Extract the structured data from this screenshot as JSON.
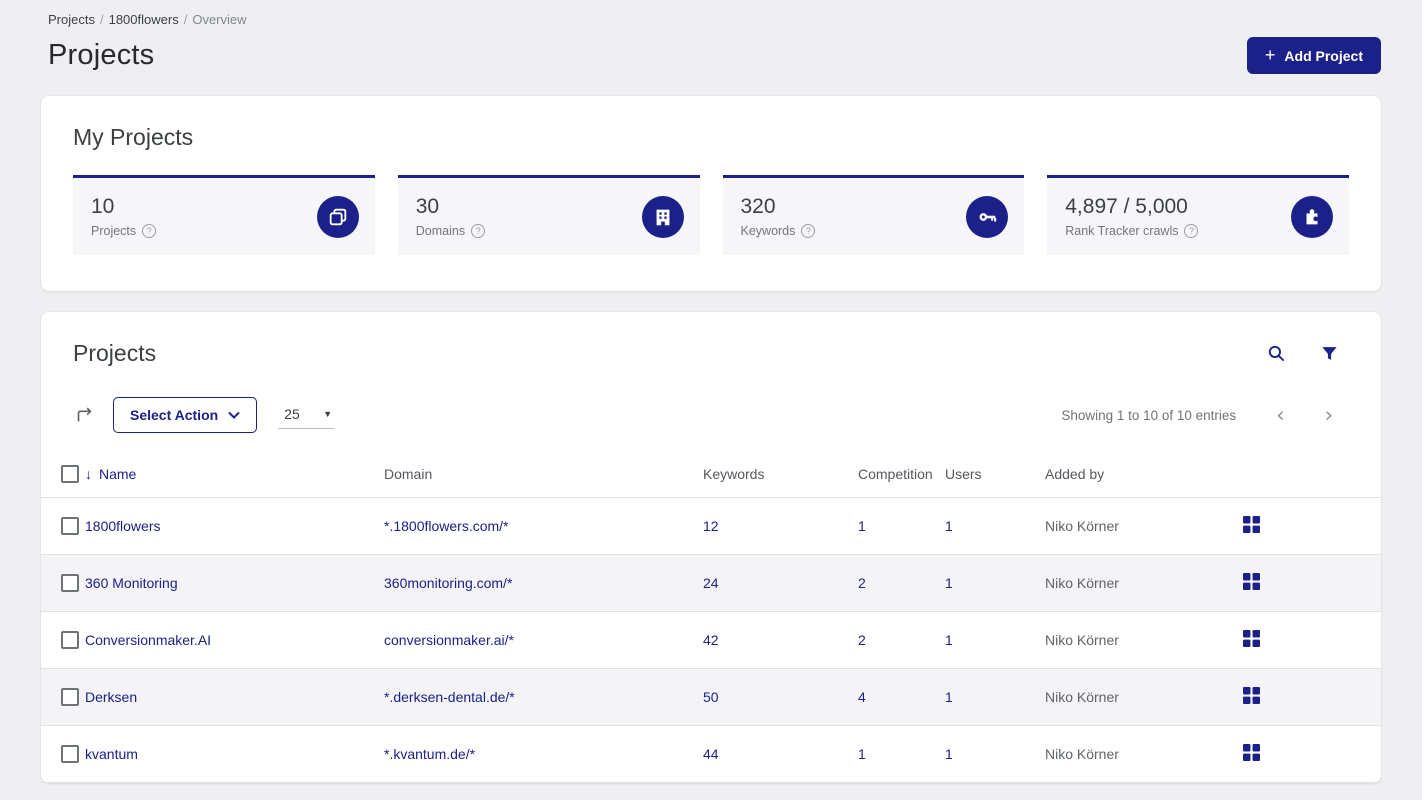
{
  "colors": {
    "brand": "#1b2188",
    "link": "#1b2188",
    "page_bg": "#efeff1"
  },
  "breadcrumb": {
    "items": [
      "Projects",
      "1800flowers",
      "Overview"
    ]
  },
  "header": {
    "title": "Projects",
    "add_button_label": "Add Project",
    "add_button_icon": "plus-icon"
  },
  "my_projects": {
    "title": "My Projects",
    "stats": [
      {
        "value": "10",
        "label": "Projects",
        "icon": "projects-icon",
        "help_icon": "help-icon"
      },
      {
        "value": "30",
        "label": "Domains",
        "icon": "domains-icon",
        "help_icon": "help-icon"
      },
      {
        "value": "320",
        "label": "Keywords",
        "icon": "key-icon",
        "help_icon": "help-icon"
      },
      {
        "value": "4,897 / 5,000",
        "label": "Rank Tracker crawls",
        "icon": "puzzle-icon",
        "help_icon": "help-icon"
      }
    ]
  },
  "projects_table": {
    "title": "Projects",
    "toolbar": {
      "export_icon": "export-arrow-icon",
      "select_action_label": "Select Action",
      "page_size_value": "25",
      "showing_text": "Showing 1 to 10 of 10 entries",
      "prev_icon": "chevron-left-icon",
      "next_icon": "chevron-right-icon",
      "search_icon": "search-icon",
      "filter_icon": "filter-icon"
    },
    "sort": {
      "column": "Name",
      "direction": "desc",
      "arrow": "↓"
    },
    "columns": [
      "Name",
      "Domain",
      "Keywords",
      "Competition",
      "Users",
      "Added by"
    ],
    "rows": [
      {
        "name": "1800flowers",
        "domain": "*.1800flowers.com/*",
        "keywords": "12",
        "competition": "1",
        "users": "1",
        "added_by": "Niko Körner",
        "actions_icon": "grid-icon"
      },
      {
        "name": "360 Monitoring",
        "domain": "360monitoring.com/*",
        "keywords": "24",
        "competition": "2",
        "users": "1",
        "added_by": "Niko Körner",
        "actions_icon": "grid-icon"
      },
      {
        "name": "Conversionmaker.AI",
        "domain": "conversionmaker.ai/*",
        "keywords": "42",
        "competition": "2",
        "users": "1",
        "added_by": "Niko Körner",
        "actions_icon": "grid-icon"
      },
      {
        "name": "Derksen",
        "domain": "*.derksen-dental.de/*",
        "keywords": "50",
        "competition": "4",
        "users": "1",
        "added_by": "Niko Körner",
        "actions_icon": "grid-icon"
      },
      {
        "name": "kvantum",
        "domain": "*.kvantum.de/*",
        "keywords": "44",
        "competition": "1",
        "users": "1",
        "added_by": "Niko Körner",
        "actions_icon": "grid-icon"
      }
    ]
  }
}
